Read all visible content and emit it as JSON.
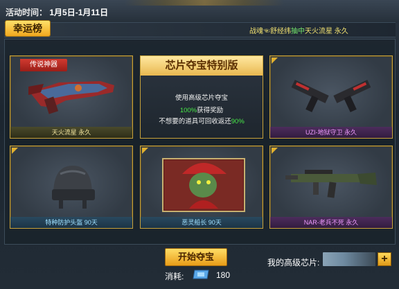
{
  "header": {
    "activity_label": "活动时间：",
    "activity_dates": "1月5日-1月11日"
  },
  "lucky": {
    "tag": "幸运榜",
    "ticker_user": "战魂",
    "ticker_user2": "舒经纬",
    "ticker_action": "抽中",
    "ticker_item": "天火流星 永久"
  },
  "cards": [
    {
      "name": "天火流星 永久",
      "badge": "传说神器",
      "style": "gold"
    },
    {
      "name": "UZI-地狱守卫 永久",
      "style": "purple"
    },
    {
      "name": "特种防护头盔 90天",
      "style": "blue"
    },
    {
      "name": "恶灵船长 90天",
      "style": "blue"
    },
    {
      "name": "NAR-老兵不死 永久",
      "style": "purple"
    }
  ],
  "info": {
    "title": "芯片夺宝特别版",
    "line1": "使用高级芯片夺宝",
    "line2_pct": "100%",
    "line2_text": "获得奖励",
    "line3_text": "不想要的道具可回收返还",
    "line3_pct": "90%"
  },
  "actions": {
    "start_label": "开始夺宝",
    "cost_label": "消耗:",
    "cost_value": "180",
    "plus_label": "+"
  },
  "chips": {
    "label": "我的高级芯片:"
  },
  "colors": {
    "gold": "#e0b02e",
    "green": "#48e848",
    "red_badge": "#d23a30"
  }
}
